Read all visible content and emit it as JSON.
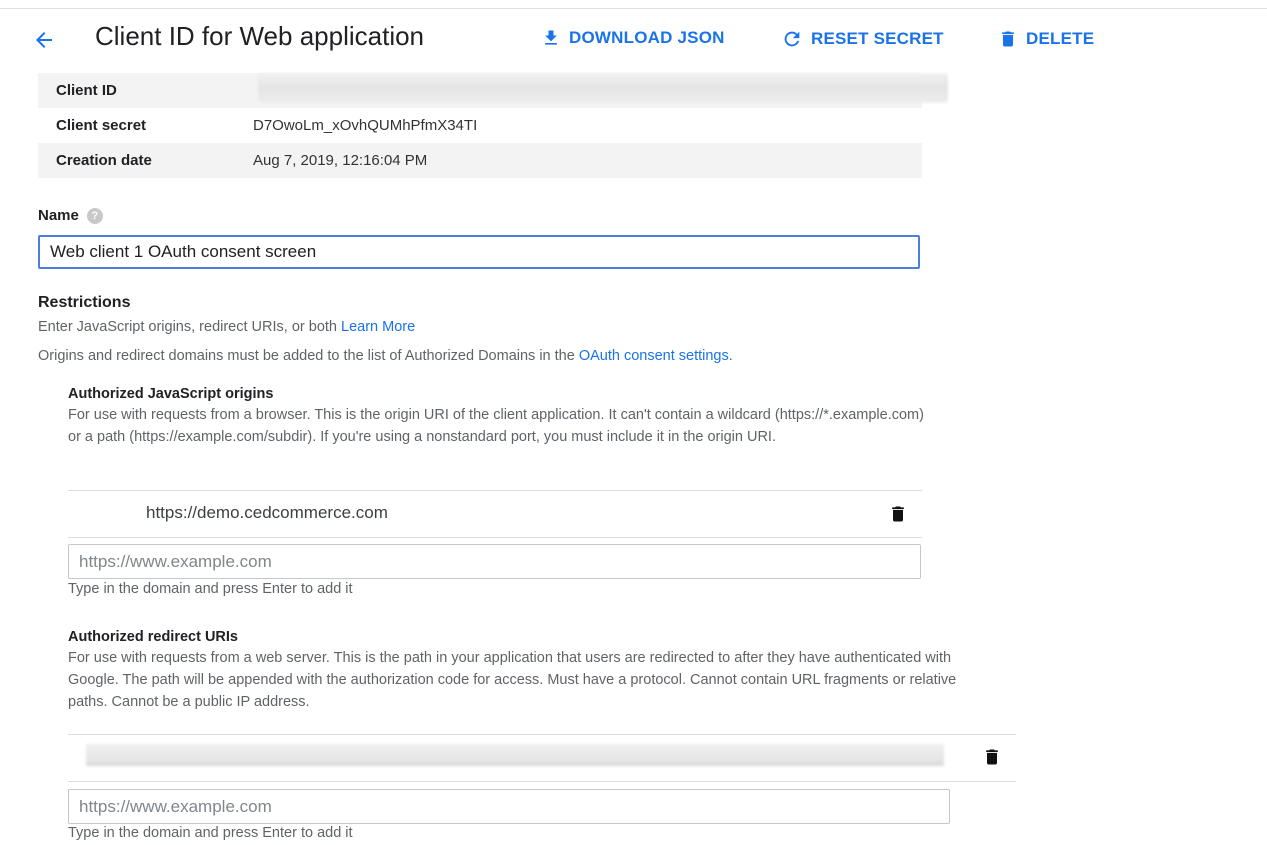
{
  "header": {
    "title": "Client ID for Web application",
    "download_label": "DOWNLOAD JSON",
    "reset_label": "RESET SECRET",
    "delete_label": "DELETE"
  },
  "info": {
    "client_id_label": "Client ID",
    "client_secret_label": "Client secret",
    "client_secret_value": "D7OwoLm_xOvhQUMhPfmX34TI",
    "creation_date_label": "Creation date",
    "creation_date_value": "Aug 7, 2019, 12:16:04 PM"
  },
  "name": {
    "label": "Name",
    "value": "Web client 1 OAuth consent screen"
  },
  "restrictions": {
    "heading": "Restrictions",
    "line1": "Enter JavaScript origins, redirect URIs, or both",
    "learn_more": "Learn More",
    "line2": "Origins and redirect domains must be added to the list of Authorized Domains in the",
    "consent_link": "OAuth consent settings",
    "line2_end": "."
  },
  "origins": {
    "heading": "Authorized JavaScript origins",
    "description": "For use with requests from a browser. This is the origin URI of the client application. It can't contain a wildcard (https://*.example.com) or a path (https://example.com/subdir). If you're using a nonstandard port, you must include it in the origin URI.",
    "entry": "https://demo.cedcommerce.com",
    "placeholder": "https://www.example.com",
    "hint": "Type in the domain and press Enter to add it"
  },
  "redirects": {
    "heading": "Authorized redirect URIs",
    "description": "For use with requests from a web server. This is the path in your application that users are redirected to after they have authenticated with Google. The path will be appended with the authorization code for access. Must have a protocol. Cannot contain URL fragments or relative paths. Cannot be a public IP address.",
    "placeholder": "https://www.example.com",
    "hint": "Type in the domain and press Enter to add it"
  },
  "colors": {
    "accent": "#1a73e8",
    "focus_border": "#4a7fe0"
  }
}
